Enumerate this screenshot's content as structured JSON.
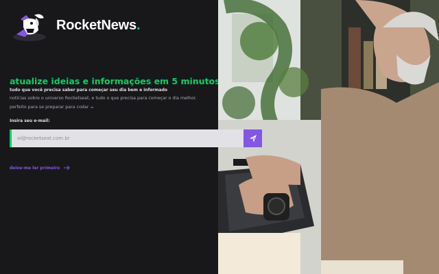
{
  "brand": {
    "name": "RocketNews",
    "dot": "."
  },
  "hero": {
    "headline": "atualize ideias e informações em 5 minutos.",
    "subtitle": "tudo que você precisa saber para começar seu dia bem e informado",
    "line1": "notícias sobre o universo Rocketseat, e tudo o que precisa para começar o dia melhor.",
    "line2": "perfeito para se preparar para codar ☕"
  },
  "form": {
    "email_label": "Insira seu e-mail:",
    "email_placeholder": "oi@rocketseat.com.br",
    "send_icon": "send-icon"
  },
  "link": {
    "read_first": "deixe-me ler primeiro",
    "icon": "arrow-right-icon"
  },
  "colors": {
    "accent_green": "#04d361",
    "accent_purple": "#8257e5",
    "background": "#18181b"
  },
  "photo": {
    "icon": "photo-person-typing-laptop"
  }
}
